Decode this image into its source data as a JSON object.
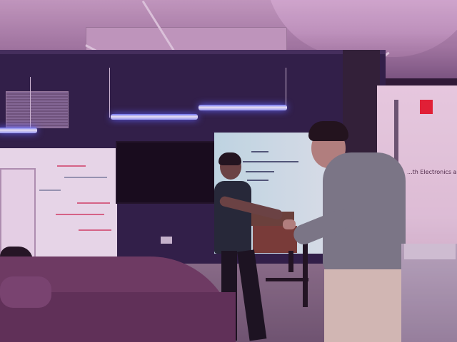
{
  "scene": {
    "type": "photo",
    "palette": {
      "wall": "#2b2046",
      "ceiling": "#c9a3c6",
      "light": "#6f7dff",
      "sofa": "#6e3e63",
      "exit": "#ee2030",
      "sweater": "#7c7f8a",
      "shirt": "#1f2a34"
    },
    "signage": {
      "door_text": "...th Electronics and Innov..."
    }
  }
}
